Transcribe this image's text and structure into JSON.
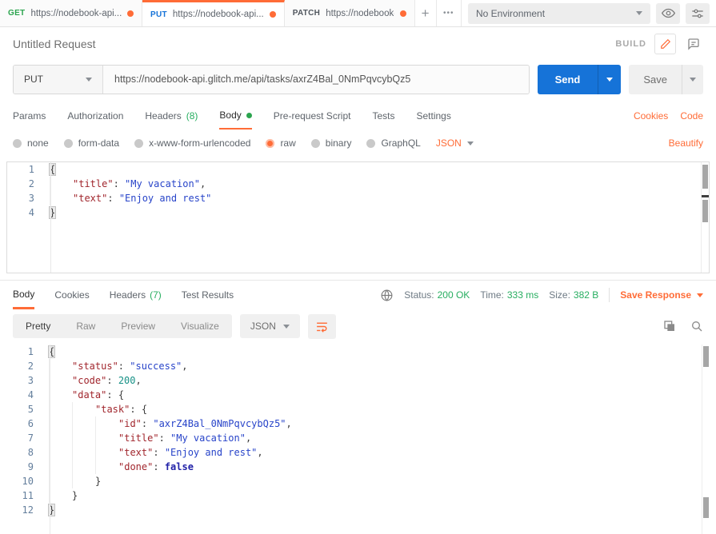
{
  "colors": {
    "accent": "#FF6C37",
    "status_green": "#27AE60",
    "send_blue": "#1673D8",
    "method_get": "#2BA44E",
    "method_put": "#1673D8",
    "method_patch": "#50565E",
    "code_key": "#A1262D",
    "code_string": "#2844C9",
    "code_number": "#169186",
    "code_atom": "#2222A8"
  },
  "icons": {
    "plus": "+",
    "more_options": "•••",
    "named": [
      "eye-icon",
      "sliders-icon",
      "pencil-icon",
      "comment-icon",
      "globe-lock-icon",
      "wrap-text-icon",
      "copy-icon",
      "search-icon",
      "chevron-down-icon",
      "radio-icon",
      "unsaved-dot-icon"
    ]
  },
  "header": {
    "tabs": [
      {
        "method": "GET",
        "url": "https://nodebook-api...",
        "unsaved": true
      },
      {
        "method": "PUT",
        "url": "https://nodebook-api...",
        "unsaved": true
      },
      {
        "method": "PATCH",
        "url": "https://nodebook-...",
        "unsaved": true
      }
    ],
    "environment": {
      "selected": "No Environment"
    }
  },
  "request": {
    "title": "Untitled Request",
    "mode_label": "BUILD",
    "method": "PUT",
    "url": "https://nodebook-api.glitch.me/api/tasks/axrZ4Bal_0NmPqvcybQz5",
    "send_label": "Send",
    "save_label": "Save",
    "tabs": [
      {
        "label": "Params"
      },
      {
        "label": "Authorization"
      },
      {
        "label": "Headers",
        "count": "(8)"
      },
      {
        "label": "Body",
        "active": true,
        "has_dot": true
      },
      {
        "label": "Pre-request Script"
      },
      {
        "label": "Tests"
      },
      {
        "label": "Settings"
      }
    ],
    "cookies_link": "Cookies",
    "code_link": "Code",
    "body_types": [
      {
        "label": "none"
      },
      {
        "label": "form-data"
      },
      {
        "label": "x-www-form-urlencoded"
      },
      {
        "label": "raw",
        "selected": true
      },
      {
        "label": "binary"
      },
      {
        "label": "GraphQL"
      }
    ],
    "content_type": "JSON",
    "beautify_label": "Beautify"
  },
  "request_editor": {
    "lines": [
      {
        "n": 1,
        "indent": 0,
        "tokens": [
          {
            "c": "punct",
            "t": "{",
            "hl": true
          }
        ]
      },
      {
        "n": 2,
        "indent": 1,
        "tokens": [
          {
            "c": "key",
            "t": "\"title\""
          },
          {
            "c": "punct",
            "t": ": "
          },
          {
            "c": "str",
            "t": "\"My vacation\""
          },
          {
            "c": "punct",
            "t": ","
          }
        ]
      },
      {
        "n": 3,
        "indent": 1,
        "tokens": [
          {
            "c": "key",
            "t": "\"text\""
          },
          {
            "c": "punct",
            "t": ": "
          },
          {
            "c": "str",
            "t": "\"Enjoy and rest\""
          }
        ]
      },
      {
        "n": 4,
        "indent": 0,
        "tokens": [
          {
            "c": "punct",
            "t": "}",
            "hl": true
          }
        ]
      }
    ]
  },
  "response": {
    "tabs": [
      {
        "label": "Body",
        "active": true
      },
      {
        "label": "Cookies"
      },
      {
        "label": "Headers",
        "count": "(7)"
      },
      {
        "label": "Test Results"
      }
    ],
    "status_label": "Status:",
    "status_value": "200 OK",
    "time_label": "Time:",
    "time_value": "333 ms",
    "size_label": "Size:",
    "size_value": "382 B",
    "save_response_label": "Save Response",
    "view_tabs": [
      {
        "label": "Pretty",
        "active": true
      },
      {
        "label": "Raw"
      },
      {
        "label": "Preview"
      },
      {
        "label": "Visualize"
      }
    ],
    "format": "JSON"
  },
  "response_editor": {
    "lines": [
      {
        "n": 1,
        "indent": 0,
        "tokens": [
          {
            "c": "punct",
            "t": "{",
            "hl": true
          }
        ]
      },
      {
        "n": 2,
        "indent": 1,
        "tokens": [
          {
            "c": "key",
            "t": "\"status\""
          },
          {
            "c": "punct",
            "t": ": "
          },
          {
            "c": "str",
            "t": "\"success\""
          },
          {
            "c": "punct",
            "t": ","
          }
        ]
      },
      {
        "n": 3,
        "indent": 1,
        "tokens": [
          {
            "c": "key",
            "t": "\"code\""
          },
          {
            "c": "punct",
            "t": ": "
          },
          {
            "c": "num",
            "t": "200"
          },
          {
            "c": "punct",
            "t": ","
          }
        ]
      },
      {
        "n": 4,
        "indent": 1,
        "tokens": [
          {
            "c": "key",
            "t": "\"data\""
          },
          {
            "c": "punct",
            "t": ": "
          },
          {
            "c": "punct",
            "t": "{"
          }
        ]
      },
      {
        "n": 5,
        "indent": 2,
        "tokens": [
          {
            "c": "key",
            "t": "\"task\""
          },
          {
            "c": "punct",
            "t": ": "
          },
          {
            "c": "punct",
            "t": "{"
          }
        ]
      },
      {
        "n": 6,
        "indent": 3,
        "tokens": [
          {
            "c": "key",
            "t": "\"id\""
          },
          {
            "c": "punct",
            "t": ": "
          },
          {
            "c": "str",
            "t": "\"axrZ4Bal_0NmPqvcybQz5\""
          },
          {
            "c": "punct",
            "t": ","
          }
        ]
      },
      {
        "n": 7,
        "indent": 3,
        "tokens": [
          {
            "c": "key",
            "t": "\"title\""
          },
          {
            "c": "punct",
            "t": ": "
          },
          {
            "c": "str",
            "t": "\"My vacation\""
          },
          {
            "c": "punct",
            "t": ","
          }
        ]
      },
      {
        "n": 8,
        "indent": 3,
        "tokens": [
          {
            "c": "key",
            "t": "\"text\""
          },
          {
            "c": "punct",
            "t": ": "
          },
          {
            "c": "str",
            "t": "\"Enjoy and rest\""
          },
          {
            "c": "punct",
            "t": ","
          }
        ]
      },
      {
        "n": 9,
        "indent": 3,
        "tokens": [
          {
            "c": "key",
            "t": "\"done\""
          },
          {
            "c": "punct",
            "t": ": "
          },
          {
            "c": "atom",
            "t": "false"
          }
        ]
      },
      {
        "n": 10,
        "indent": 2,
        "tokens": [
          {
            "c": "punct",
            "t": "}"
          }
        ]
      },
      {
        "n": 11,
        "indent": 1,
        "tokens": [
          {
            "c": "punct",
            "t": "}"
          }
        ]
      },
      {
        "n": 12,
        "indent": 0,
        "tokens": [
          {
            "c": "punct",
            "t": "}",
            "hl": true
          }
        ]
      }
    ]
  }
}
